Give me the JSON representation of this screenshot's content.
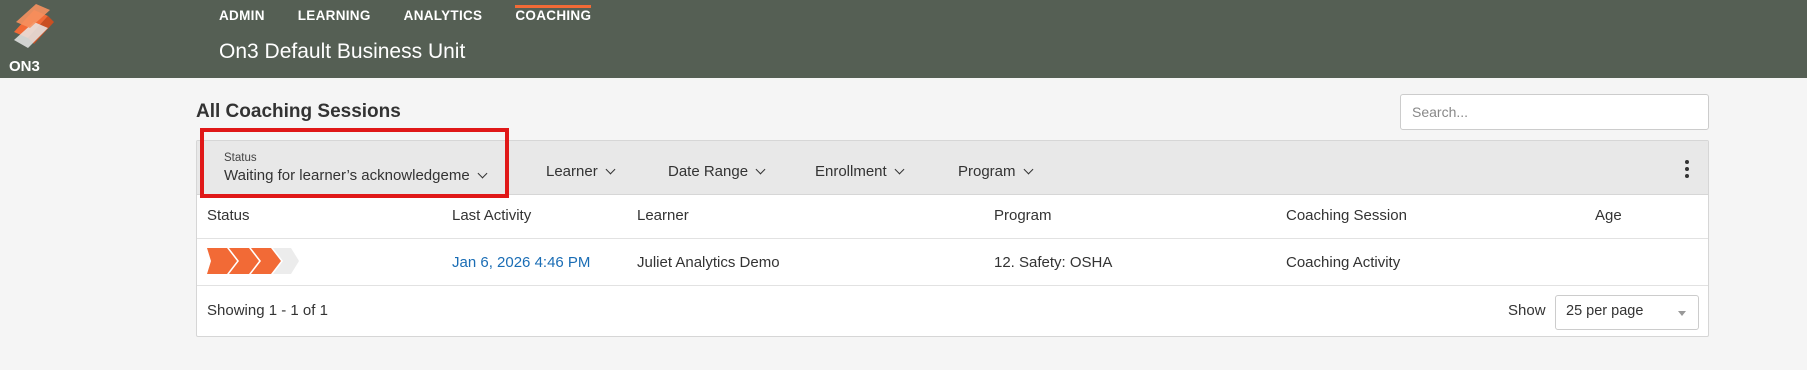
{
  "header": {
    "logo_text": "ON3",
    "nav": [
      {
        "label": "ADMIN",
        "active": false
      },
      {
        "label": "LEARNING",
        "active": false
      },
      {
        "label": "ANALYTICS",
        "active": false
      },
      {
        "label": "COACHING",
        "active": true
      }
    ],
    "business_unit": "On3 Default Business Unit",
    "colors": {
      "bar": "#555f54",
      "accent": "#f26a36"
    }
  },
  "page": {
    "title": "All Coaching Sessions",
    "search_placeholder": "Search..."
  },
  "filters": {
    "status_label": "Status",
    "status_value": "Waiting for learner’s acknowledgeme",
    "learner": "Learner",
    "date_range": "Date Range",
    "enrollment": "Enrollment",
    "program": "Program"
  },
  "table": {
    "columns": [
      "Status",
      "Last Activity",
      "Learner",
      "Program",
      "Coaching Session",
      "Age"
    ],
    "rows": [
      {
        "status_icon": "progress-chevrons-icon",
        "status_steps_completed": 3,
        "status_steps_total": 4,
        "last_activity": "Jan 6, 2026 4:46 PM",
        "learner": "Juliet Analytics Demo",
        "program": "12. Safety: OSHA",
        "coaching_session": "Coaching Activity",
        "age": ""
      }
    ]
  },
  "footer": {
    "showing": "Showing 1 - 1 of 1",
    "show_label": "Show",
    "per_page": "25 per page"
  }
}
